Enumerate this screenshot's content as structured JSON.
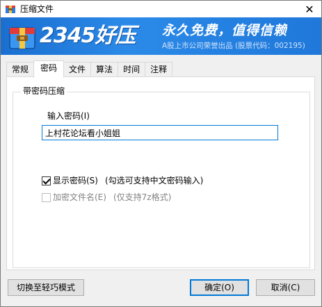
{
  "window": {
    "title": "压缩文件",
    "close_glyph": "✕"
  },
  "banner": {
    "brand": "2345好压",
    "slogan": "永久免费，值得信赖",
    "subtitle": "A股上市公司荣誉出品 (股票代码：002195)",
    "brand_color": "#1f78da"
  },
  "tabs": [
    {
      "label": "常规",
      "active": false
    },
    {
      "label": "密码",
      "active": true
    },
    {
      "label": "文件",
      "active": false
    },
    {
      "label": "算法",
      "active": false
    },
    {
      "label": "时间",
      "active": false
    },
    {
      "label": "注释",
      "active": false
    }
  ],
  "password_group": {
    "title": "带密码压缩",
    "input_label": "输入密码(I)",
    "input_value": "上村花论坛看小姐姐",
    "show_password": {
      "label": "显示密码(S)",
      "hint": "(勾选可支持中文密码输入)",
      "checked": true
    },
    "encrypt_names": {
      "label": "加密文件名(E)",
      "hint": "(仅支持7z格式)",
      "checked": false,
      "disabled": true
    }
  },
  "buttons": {
    "switch_mode": "切换至轻巧模式",
    "ok": "确定(O)",
    "cancel": "取消(C)"
  },
  "colors": {
    "accent": "#0078d7"
  }
}
